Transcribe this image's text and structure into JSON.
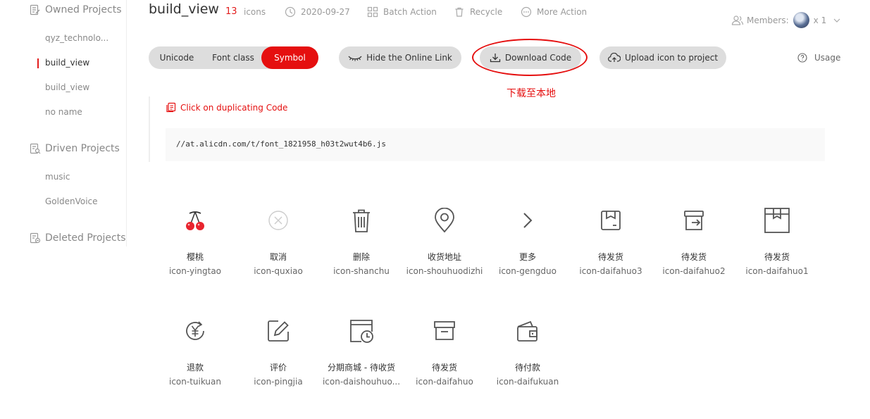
{
  "sidebar": {
    "owned_label": "Owned Projects",
    "owned_items": [
      "qyz_technolo...",
      "build_view",
      "build_view",
      "no name"
    ],
    "driven_label": "Driven Projects",
    "driven_items": [
      "music",
      "GoldenVoice"
    ],
    "deleted_label": "Deleted Projects"
  },
  "header": {
    "title": "build_view",
    "count": "13",
    "count_unit": "icons",
    "date": "2020-09-27",
    "batch_action": "Batch Action",
    "recycle": "Recycle",
    "more_action": "More Action",
    "members_label": "Members:",
    "members_count": "x 1"
  },
  "tabs": {
    "unicode": "Unicode",
    "font_class": "Font class",
    "symbol": "Symbol",
    "active": "Symbol"
  },
  "actions": {
    "hide_link": "Hide the Online Link",
    "download": "Download Code",
    "upload": "Upload icon to project",
    "usage": "Usage"
  },
  "annotation": "下载至本地",
  "code": {
    "copy_hint": "Click on duplicating Code",
    "url": "//at.alicdn.com/t/font_1821958_h03t2wut4b6.js"
  },
  "icons": [
    {
      "name": "樱桃",
      "font": "icon-yingtao",
      "glyph": "cherry-icon"
    },
    {
      "name": "取消",
      "font": "icon-quxiao",
      "glyph": "cancel-circle-icon"
    },
    {
      "name": "删除",
      "font": "icon-shanchu",
      "glyph": "trash-icon"
    },
    {
      "name": "收货地址",
      "font": "icon-shouhuodizhi",
      "glyph": "location-pin-icon"
    },
    {
      "name": "更多",
      "font": "icon-gengduo",
      "glyph": "chevron-right-icon"
    },
    {
      "name": "待发货",
      "font": "icon-daifahuo3",
      "glyph": "box-square-icon"
    },
    {
      "name": "待发货",
      "font": "icon-daifahuo2",
      "glyph": "box-send-icon"
    },
    {
      "name": "待发货",
      "font": "icon-daifahuo1",
      "glyph": "package-icon"
    },
    {
      "name": "退款",
      "font": "icon-tuikuan",
      "glyph": "refund-icon"
    },
    {
      "name": "评价",
      "font": "icon-pingjia",
      "glyph": "edit-review-icon"
    },
    {
      "name": "分期商城 - 待收货",
      "font": "icon-daishouhuo...",
      "glyph": "calendar-clock-icon"
    },
    {
      "name": "待发货",
      "font": "icon-daifahuo",
      "glyph": "archive-box-icon"
    },
    {
      "name": "待付款",
      "font": "icon-daifukuan",
      "glyph": "wallet-icon"
    }
  ],
  "colors": {
    "accent": "#e50f0f",
    "pill_bg": "#dddddd",
    "icon_gray": "#555555"
  }
}
